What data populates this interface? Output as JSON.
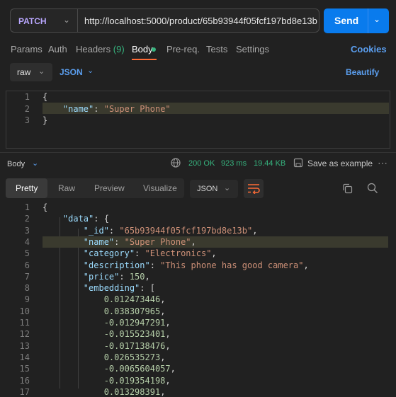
{
  "request": {
    "method": "PATCH",
    "url": "http://localhost:5000/product/65b93944f05fcf197bd8e13b",
    "send_label": "Send"
  },
  "tabs": {
    "params": "Params",
    "auth": "Auth",
    "headers": "Headers",
    "headers_count": "(9)",
    "body": "Body",
    "prereq": "Pre-req.",
    "tests": "Tests",
    "settings": "Settings",
    "cookies": "Cookies"
  },
  "body_options": {
    "mode": "raw",
    "format": "JSON",
    "beautify": "Beautify"
  },
  "request_body": {
    "lines": [
      {
        "n": "1",
        "parts": [
          [
            "punc",
            "{"
          ]
        ]
      },
      {
        "n": "2",
        "parts": [
          [
            "punc",
            "    "
          ],
          [
            "key",
            "\"name\""
          ],
          [
            "punc",
            ": "
          ],
          [
            "str",
            "\"Super Phone\""
          ]
        ]
      },
      {
        "n": "3",
        "parts": [
          [
            "punc",
            "}"
          ]
        ]
      }
    ]
  },
  "response": {
    "label": "Body",
    "status": "200 OK",
    "time": "923 ms",
    "size": "19.44 KB",
    "save_example": "Save as example",
    "more": "⋯",
    "view_tabs": [
      "Pretty",
      "Raw",
      "Preview",
      "Visualize"
    ],
    "format": "JSON",
    "lines": [
      {
        "n": "1",
        "parts": [
          [
            "punc",
            "{"
          ]
        ]
      },
      {
        "n": "2",
        "parts": [
          [
            "punc",
            "    "
          ],
          [
            "key",
            "\"data\""
          ],
          [
            "punc",
            ": {"
          ]
        ]
      },
      {
        "n": "3",
        "parts": [
          [
            "punc",
            "        "
          ],
          [
            "key",
            "\"_id\""
          ],
          [
            "punc",
            ": "
          ],
          [
            "str",
            "\"65b93944f05fcf197bd8e13b\""
          ],
          [
            "punc",
            ","
          ]
        ]
      },
      {
        "n": "4",
        "parts": [
          [
            "punc",
            "        "
          ],
          [
            "key",
            "\"name\""
          ],
          [
            "punc",
            ": "
          ],
          [
            "str",
            "\"Super Phone\""
          ],
          [
            "punc",
            ","
          ]
        ]
      },
      {
        "n": "5",
        "parts": [
          [
            "punc",
            "        "
          ],
          [
            "key",
            "\"category\""
          ],
          [
            "punc",
            ": "
          ],
          [
            "str",
            "\"Electronics\""
          ],
          [
            "punc",
            ","
          ]
        ]
      },
      {
        "n": "6",
        "parts": [
          [
            "punc",
            "        "
          ],
          [
            "key",
            "\"description\""
          ],
          [
            "punc",
            ": "
          ],
          [
            "str",
            "\"This phone has good camera\""
          ],
          [
            "punc",
            ","
          ]
        ]
      },
      {
        "n": "7",
        "parts": [
          [
            "punc",
            "        "
          ],
          [
            "key",
            "\"price\""
          ],
          [
            "punc",
            ": "
          ],
          [
            "num",
            "150"
          ],
          [
            "punc",
            ","
          ]
        ]
      },
      {
        "n": "8",
        "parts": [
          [
            "punc",
            "        "
          ],
          [
            "key",
            "\"embedding\""
          ],
          [
            "punc",
            ": ["
          ]
        ]
      },
      {
        "n": "9",
        "parts": [
          [
            "punc",
            "            "
          ],
          [
            "num",
            "0.012473446"
          ],
          [
            "punc",
            ","
          ]
        ]
      },
      {
        "n": "10",
        "parts": [
          [
            "punc",
            "            "
          ],
          [
            "num",
            "0.038307965"
          ],
          [
            "punc",
            ","
          ]
        ]
      },
      {
        "n": "11",
        "parts": [
          [
            "punc",
            "            "
          ],
          [
            "num",
            "-0.012947291"
          ],
          [
            "punc",
            ","
          ]
        ]
      },
      {
        "n": "12",
        "parts": [
          [
            "punc",
            "            "
          ],
          [
            "num",
            "-0.015523401"
          ],
          [
            "punc",
            ","
          ]
        ]
      },
      {
        "n": "13",
        "parts": [
          [
            "punc",
            "            "
          ],
          [
            "num",
            "-0.017138476"
          ],
          [
            "punc",
            ","
          ]
        ]
      },
      {
        "n": "14",
        "parts": [
          [
            "punc",
            "            "
          ],
          [
            "num",
            "0.026535273"
          ],
          [
            "punc",
            ","
          ]
        ]
      },
      {
        "n": "15",
        "parts": [
          [
            "punc",
            "            "
          ],
          [
            "num",
            "-0.0065604057"
          ],
          [
            "punc",
            ","
          ]
        ]
      },
      {
        "n": "16",
        "parts": [
          [
            "punc",
            "            "
          ],
          [
            "num",
            "-0.019354198"
          ],
          [
            "punc",
            ","
          ]
        ]
      },
      {
        "n": "17",
        "parts": [
          [
            "punc",
            "            "
          ],
          [
            "num",
            "0.013298391"
          ],
          [
            "punc",
            ","
          ]
        ]
      }
    ]
  },
  "colors": {
    "accent": "#097bed",
    "method": "#b9a7ff",
    "active_tab_underline": "#ff6c37",
    "status_ok": "#36b37e"
  }
}
